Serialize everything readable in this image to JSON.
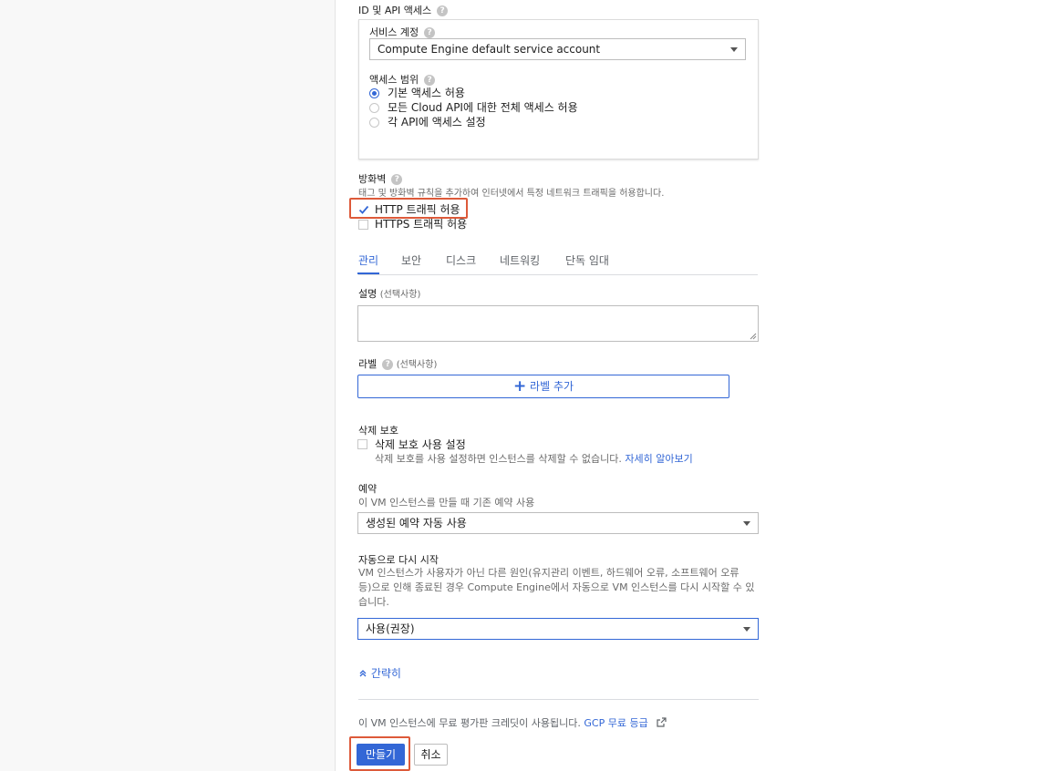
{
  "identity": {
    "section_title": "ID 및 API 액세스",
    "help_icon": "?",
    "service_account": {
      "label": "서비스 계정",
      "selected": "Compute Engine default service account"
    },
    "access_scope": {
      "label": "액세스 범위",
      "options": [
        "기본 액세스 허용",
        "모든 Cloud API에 대한 전체 액세스 허용",
        "각 API에 액세스 설정"
      ],
      "selected_index": 0
    }
  },
  "firewall": {
    "title": "방화벽",
    "description": "태그 및 방화벽 규칙을 추가하여 인터넷에서 특정 네트워크 트래픽을 허용합니다.",
    "http_label": "HTTP 트래픽 허용",
    "http_checked": true,
    "https_label": "HTTPS 트래픽 허용",
    "https_checked": false
  },
  "tabs": [
    "관리",
    "보안",
    "디스크",
    "네트워킹",
    "단독 임대"
  ],
  "active_tab": "관리",
  "description_field": {
    "label": "설명",
    "optional": "(선택사항)",
    "value": ""
  },
  "labels_field": {
    "label": "라벨",
    "optional": "(선택사항)",
    "add_button": "라벨 추가"
  },
  "deletion_protection": {
    "title": "삭제 보호",
    "checkbox_label": "삭제 보호 사용 설정",
    "description": "삭제 보호를 사용 설정하면 인스턴스를 삭제할 수 없습니다.",
    "link": "자세히 알아보기"
  },
  "reservation": {
    "title": "예약",
    "description": "이 VM 인스턴스를 만들 때 기존 예약 사용",
    "selected": "생성된 예약 자동 사용"
  },
  "auto_restart": {
    "title": "자동으로 다시 시작",
    "description_lines": [
      "VM 인스턴스가 사용자가 아닌 다른 원인(유지관리 이벤트, 하드웨어 오류, 소프트웨어 오류",
      "등)으로 인해 종료된 경우 Compute Engine에서 자동으로 VM 인스턴스를 다시 시작할 수 있",
      "습니다."
    ],
    "selected": "사용(권장)"
  },
  "collapse_link": "간략히",
  "free_trial": {
    "text": "이 VM 인스턴스에 무료 평가판 크레딧이 사용됩니다.",
    "link": "GCP 무료 등급"
  },
  "actions": {
    "create": "만들기",
    "cancel": "취소"
  },
  "colors": {
    "accent": "#3367d6",
    "highlight": "#dd5a3a"
  }
}
